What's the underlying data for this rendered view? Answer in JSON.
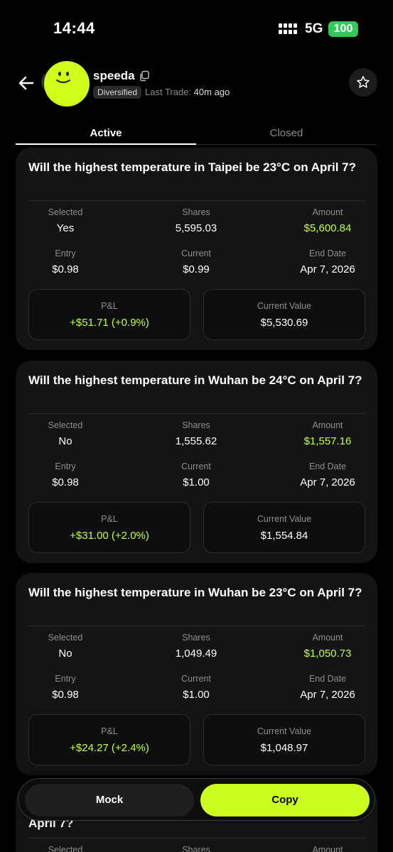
{
  "status_bar": {
    "time": "14:44",
    "network": "5G",
    "battery": "100"
  },
  "profile": {
    "username": "speeda",
    "tag": "Diversified",
    "last_trade_label": "Last Trade:",
    "last_trade_value": "40m ago"
  },
  "tabs": [
    {
      "label": "Active",
      "active": true
    },
    {
      "label": "Closed",
      "active": false
    }
  ],
  "labels": {
    "selected": "Selected",
    "shares": "Shares",
    "amount": "Amount",
    "entry": "Entry",
    "current": "Current",
    "end_date": "End Date",
    "pnl": "P&L",
    "current_value": "Current Value"
  },
  "positions": [
    {
      "title": "Will the highest temperature in Taipei be 23°C on April 7?",
      "selected": "Yes",
      "shares": "5,595.03",
      "amount": "$5,600.84",
      "entry": "$0.98",
      "current": "$0.99",
      "end_date": "Apr 7, 2026",
      "pnl": "+$51.71 (+0.9%)",
      "current_value": "$5,530.69"
    },
    {
      "title": "Will the highest temperature in Wuhan be 24°C on April 7?",
      "selected": "No",
      "shares": "1,555.62",
      "amount": "$1,557.16",
      "entry": "$0.98",
      "current": "$1.00",
      "end_date": "Apr 7, 2026",
      "pnl": "+$31.00 (+2.0%)",
      "current_value": "$1,554.84"
    },
    {
      "title": "Will the highest temperature in Wuhan be 23°C on April 7?",
      "selected": "No",
      "shares": "1,049.49",
      "amount": "$1,050.73",
      "entry": "$0.98",
      "current": "$1.00",
      "end_date": "Apr 7, 2026",
      "pnl": "+$24.27 (+2.4%)",
      "current_value": "$1,048.97"
    }
  ],
  "partial_card": {
    "title_fragment": "April 7?"
  },
  "actions": {
    "mock": "Mock",
    "copy": "Copy"
  },
  "colors": {
    "accent": "#ccff1f",
    "positive": "#c2ff3a",
    "card_bg": "#141414",
    "battery": "#34c759"
  }
}
